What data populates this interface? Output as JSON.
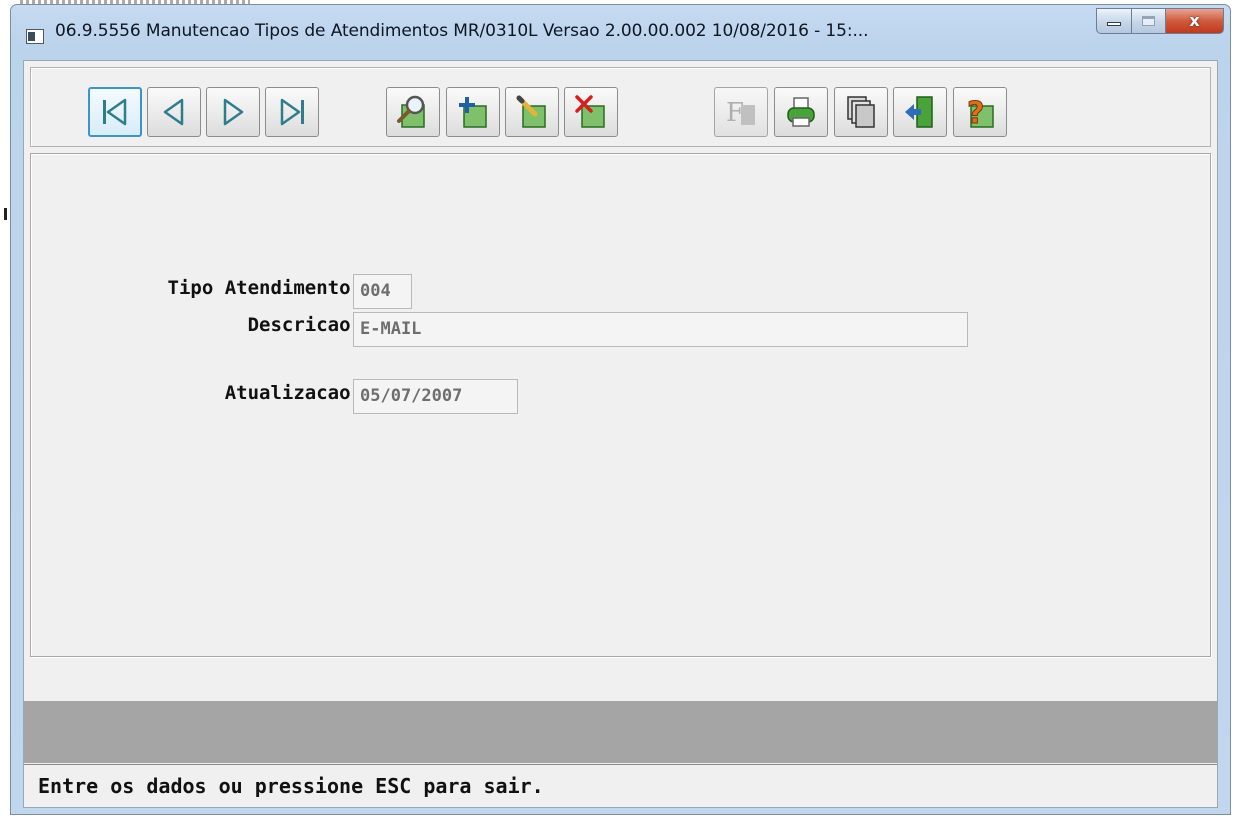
{
  "window": {
    "title": "06.9.5556 Manutencao  Tipos de Atendimentos MR/0310L Versao 2.00.00.002 10/08/2016 - 15:...",
    "close_label": "x"
  },
  "toolbar": {
    "nav": [
      {
        "icon": "first-record-icon"
      },
      {
        "icon": "previous-record-icon"
      },
      {
        "icon": "next-record-icon"
      },
      {
        "icon": "last-record-icon"
      }
    ],
    "actions": [
      {
        "icon": "search-icon"
      },
      {
        "icon": "add-record-icon"
      },
      {
        "icon": "edit-record-icon"
      },
      {
        "icon": "delete-record-icon"
      }
    ],
    "tools": [
      {
        "icon": "filter-icon",
        "disabled": true,
        "glyph": "F"
      },
      {
        "icon": "print-icon"
      },
      {
        "icon": "copy-icon"
      },
      {
        "icon": "exit-icon"
      },
      {
        "icon": "help-icon",
        "glyph": "?"
      }
    ]
  },
  "form": {
    "tipo_label": "Tipo Atendimento:",
    "tipo_value": "004",
    "descricao_label": "Descricao:",
    "descricao_value": "E-MAIL",
    "atualizacao_label": "Atualizacao:",
    "atualizacao_value": "05/07/2007"
  },
  "status": {
    "message": "Entre os dados ou pressione ESC para sair."
  },
  "colors": {
    "accent_green": "#4aa33a",
    "icon_teal": "#2f7d8c",
    "delete_red": "#d42020",
    "help_orange": "#e07018"
  }
}
